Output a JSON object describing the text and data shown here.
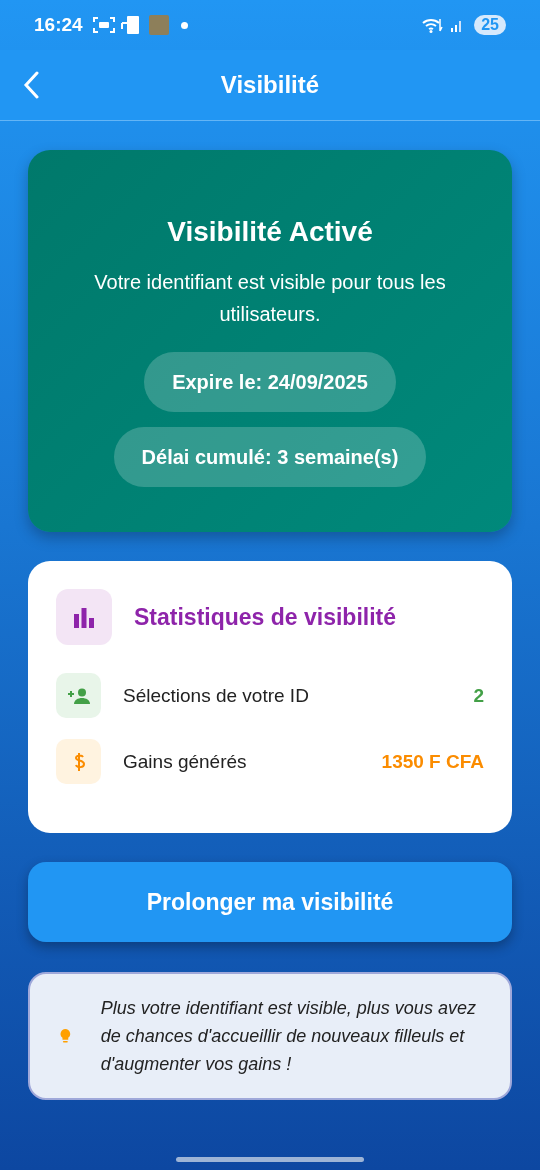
{
  "status_bar": {
    "time": "16:24",
    "battery": "25"
  },
  "header": {
    "title": "Visibilité"
  },
  "status_card": {
    "title": "Visibilité Activé",
    "message": "Votre identifiant est visible pour tous les utilisateurs.",
    "pills": [
      "Expire le: 24/09/2025",
      "Délai cumulé: 3 semaine(s)"
    ]
  },
  "stats": {
    "title": "Statistiques de visibilité",
    "rows": [
      {
        "kind": "selections",
        "label": "Sélections de votre ID",
        "value": "2",
        "color": "#43a047"
      },
      {
        "kind": "earnings",
        "label": "Gains générés",
        "value": "1350 F CFA",
        "color": "#fb8c00"
      }
    ]
  },
  "extend_button": "Prolonger ma visibilité",
  "tip": "Plus votre identifiant est visible, plus vous avez de chances d'accueillir de nouveaux filleuls et d'augmenter vos gains !"
}
